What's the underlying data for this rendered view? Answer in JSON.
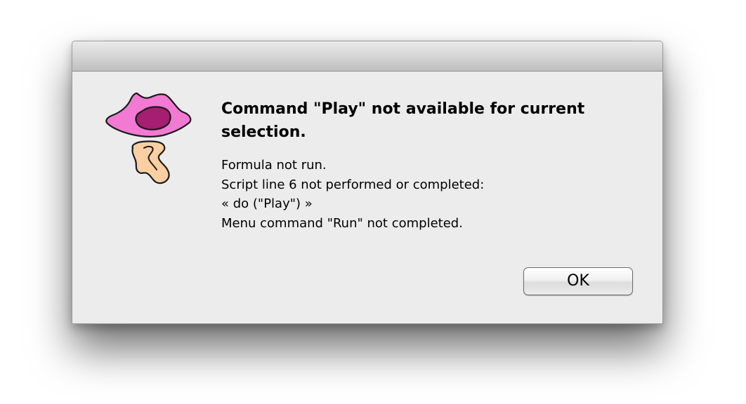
{
  "dialog": {
    "title": "Command \"Play\" not available for current selection.",
    "lines": [
      "Formula not run.",
      "Script line 6 not performed or completed:",
      "« do (\"Play\") »",
      "Menu command \"Run\" not completed."
    ],
    "ok_label": "OK",
    "icon": "app-lips-icon"
  }
}
